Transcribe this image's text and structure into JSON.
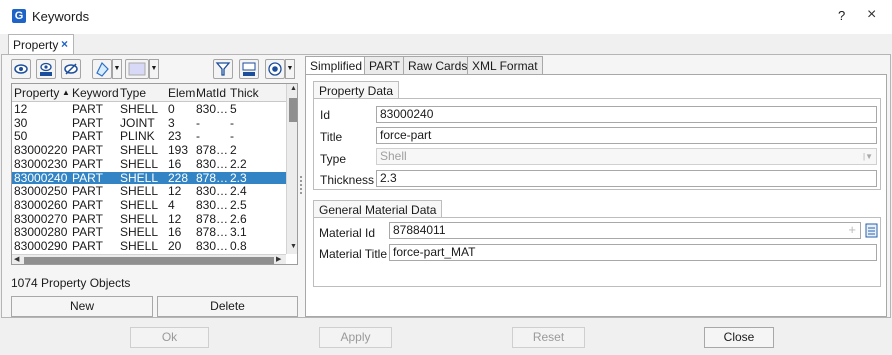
{
  "window": {
    "title": "Keywords",
    "help": "?",
    "close": "×"
  },
  "property_tab": {
    "label": "Property",
    "close": "×"
  },
  "toolbar": {
    "icons": [
      "eye-icon",
      "show-only-icon",
      "hide-icon",
      "color-icon",
      "color-swatch",
      "filter-icon",
      "filter-only-icon",
      "radio-target-icon"
    ],
    "swatch_color": "#d8d8f7"
  },
  "table": {
    "columns": [
      "Property",
      "Keyword",
      "Type",
      "Elem",
      "MatId",
      "Thick"
    ],
    "sort_indicator": "▲",
    "rows": [
      [
        "12",
        "PART",
        "SHELL",
        "0",
        "830…",
        "5"
      ],
      [
        "30",
        "PART",
        "JOINT",
        "3",
        "-",
        "-"
      ],
      [
        "50",
        "PART",
        "PLINK",
        "23",
        "-",
        "-"
      ],
      [
        "83000220",
        "PART",
        "SHELL",
        "193",
        "878…",
        "2"
      ],
      [
        "83000230",
        "PART",
        "SHELL",
        "16",
        "830…",
        "2.2"
      ],
      [
        "83000240",
        "PART",
        "SHELL",
        "228",
        "878…",
        "2.3"
      ],
      [
        "83000250",
        "PART",
        "SHELL",
        "12",
        "830…",
        "2.4"
      ],
      [
        "83000260",
        "PART",
        "SHELL",
        "4",
        "830…",
        "2.5"
      ],
      [
        "83000270",
        "PART",
        "SHELL",
        "12",
        "878…",
        "2.6"
      ],
      [
        "83000280",
        "PART",
        "SHELL",
        "16",
        "878…",
        "3.1"
      ],
      [
        "83000290",
        "PART",
        "SHELL",
        "20",
        "830…",
        "0.8"
      ]
    ],
    "selected_index": 5
  },
  "count_label": "1074 Property Objects",
  "list_buttons": {
    "new": "New",
    "delete": "Delete"
  },
  "right_tabs": [
    "Simplified",
    "PART",
    "Raw Cards",
    "XML Format"
  ],
  "property_data": {
    "group": "Property Data",
    "id_label": "Id",
    "id_value": "83000240",
    "title_label": "Title",
    "title_value": "force-part",
    "type_label": "Type",
    "type_value": "Shell",
    "thickness_label": "Thickness",
    "thickness_value": "2.3"
  },
  "material_data": {
    "group": "General Material Data",
    "id_label": "Material Id",
    "id_value": "87884011",
    "title_label": "Material Title",
    "title_value": "force-part_MAT"
  },
  "footer": {
    "ok": "Ok",
    "apply": "Apply",
    "reset": "Reset",
    "close": "Close"
  }
}
